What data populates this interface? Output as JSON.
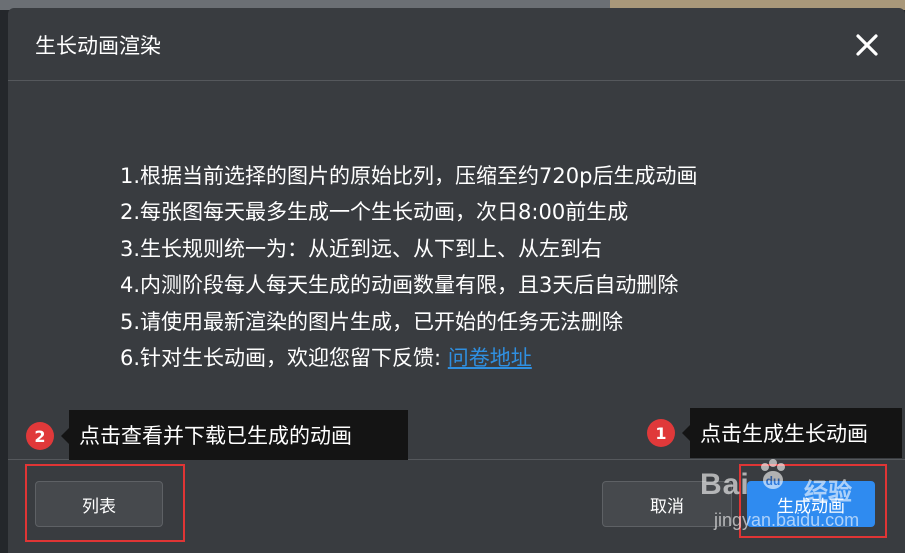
{
  "dialog": {
    "title": "生长动画渲染",
    "close_icon": "close-icon"
  },
  "rules": [
    "1.根据当前选择的图片的原始比列，压缩至约720p后生成动画",
    "2.每张图每天最多生成一个生长动画，次日8:00前生成",
    "3.生长规则统一为：从近到远、从下到上、从左到右",
    "4.内测阶段每人每天生成的动画数量有限，且3天后自动删除",
    "5.请使用最新渲染的图片生成，已开始的任务无法删除",
    "6.针对生长动画，欢迎您留下反馈: "
  ],
  "survey_link": "问卷地址",
  "buttons": {
    "list": "列表",
    "cancel": "取消",
    "generate": "生成动画"
  },
  "annotations": [
    {
      "step": "1",
      "text": "点击生成生长动画"
    },
    {
      "step": "2",
      "text": "点击查看并下载已生成的动画"
    }
  ],
  "watermark": {
    "brand": "Bai",
    "brand_suffix": "经验",
    "url": "jingyan.baidu.com"
  },
  "colors": {
    "dialog_bg": "#393c40",
    "primary": "#2f8bf0",
    "link": "#2f8fe0",
    "annotation_red": "#e03535"
  }
}
